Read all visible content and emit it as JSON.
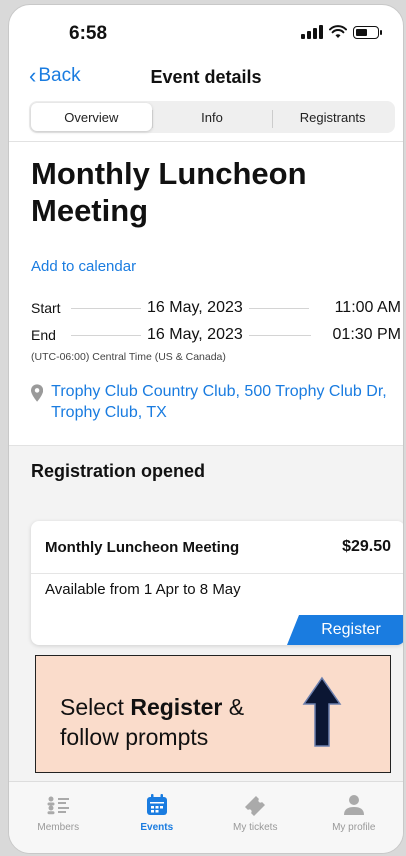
{
  "status_bar": {
    "time": "6:58"
  },
  "nav": {
    "back_label": "Back",
    "title": "Event details"
  },
  "tabs": [
    {
      "label": "Overview",
      "active": true
    },
    {
      "label": "Info",
      "active": false
    },
    {
      "label": "Registrants",
      "active": false
    }
  ],
  "event": {
    "title": "Monthly Luncheon Meeting",
    "add_to_calendar": "Add to calendar",
    "start": {
      "label": "Start",
      "date": "16 May, 2023",
      "time": "11:00 AM"
    },
    "end": {
      "label": "End",
      "date": "16 May, 2023",
      "time": "01:30 PM"
    },
    "timezone": "(UTC-06:00) Central Time (US & Canada)",
    "location": "Trophy Club Country Club, 500 Trophy Club Dr, Trophy Club, TX"
  },
  "registration": {
    "status": "Registration opened",
    "ticket": {
      "name": "Monthly Luncheon Meeting",
      "price": "$29.50",
      "availability": "Available from 1 Apr to 8 May",
      "button_label": "Register"
    }
  },
  "callout": {
    "prefix": "Select ",
    "bold": "Register",
    "suffix": " &",
    "line2": "follow prompts"
  },
  "tab_bar": [
    {
      "label": "Members",
      "icon": "members-icon",
      "active": false
    },
    {
      "label": "Events",
      "icon": "calendar-icon",
      "active": true
    },
    {
      "label": "My tickets",
      "icon": "ticket-icon",
      "active": false
    },
    {
      "label": "My profile",
      "icon": "person-icon",
      "active": false
    }
  ],
  "colors": {
    "accent": "#1a7ce0",
    "callout_bg": "#fadccb"
  }
}
